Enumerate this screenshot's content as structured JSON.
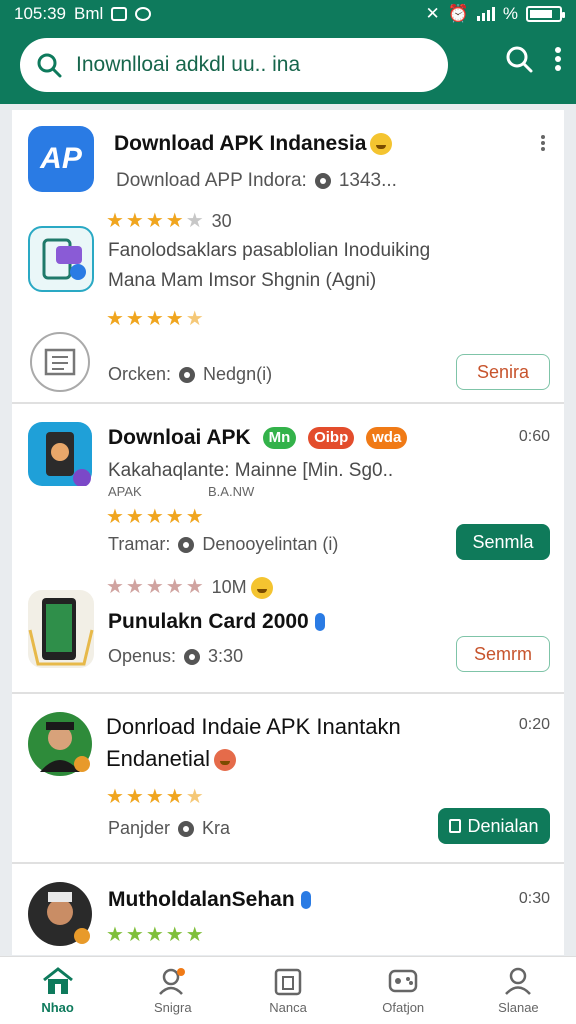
{
  "status": {
    "time": "105:39",
    "network": "Bml",
    "battery_label": "%",
    "battery_level": 0.8
  },
  "search": {
    "value": "Inownlloai adkdl uu.. ina"
  },
  "apps": [
    {
      "title": "Download APK Indanesia",
      "subtitle": "Download APP Indora:",
      "subtitle_extra": "1343...",
      "rating": 4,
      "rating_count": "30",
      "icon_text": "AP"
    },
    {
      "desc_line1": "Fanolodsaklars pasablolian Inoduiking",
      "desc_line2": "Mana Mam Imsor Shgnin (Agni)",
      "rating": 4.5
    },
    {
      "meta_left": "Orcken:",
      "meta_right": "Nedgn(i)",
      "button": "Senira"
    },
    {
      "title": "Downloai APK",
      "tag1": "Mn",
      "tag2": "Oibp",
      "tag3": "wda",
      "time": "0:60",
      "subtitle": "Kakahaqlante: Mainne [Min. Sg0..",
      "small_left": "APAK",
      "small_right": "B.A.NW",
      "rating": 5,
      "meta_left": "Tramar:",
      "meta_right": "Denooyelintan (i)",
      "button": "Senmla"
    },
    {
      "rating": 5,
      "rating_count": "10M",
      "title": "Punulakn Card 2000",
      "meta_left": "Openus:",
      "meta_right": "3:30",
      "button": "Semrm"
    },
    {
      "title_line1": "Donrload Indaie APK Inantakn",
      "title_line2": "Endanetial",
      "time": "0:20",
      "rating": 4.5,
      "meta_left": "Panjder",
      "meta_right": "Kra",
      "button": "Denialan"
    },
    {
      "title": "MutholdalanSehan",
      "time": "0:30",
      "rating": 5
    }
  ],
  "nav": [
    {
      "label": "Nhao",
      "icon": "home-icon"
    },
    {
      "label": "Snigra",
      "icon": "profile-icon"
    },
    {
      "label": "Nanca",
      "icon": "box-icon"
    },
    {
      "label": "Ofatjon",
      "icon": "game-icon"
    },
    {
      "label": "Slanae",
      "icon": "user-icon"
    }
  ],
  "colors": {
    "brand": "#0e7a5c",
    "star": "#f0a51e",
    "outline_button_text": "#c7542d"
  }
}
